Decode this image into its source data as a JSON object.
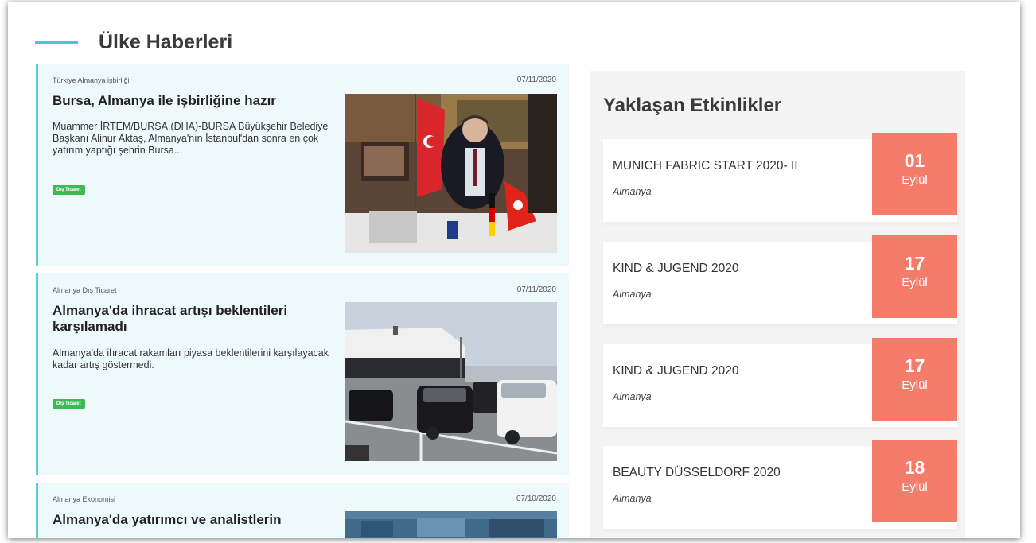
{
  "section": {
    "title": "Ülke Haberleri"
  },
  "news": [
    {
      "category": "Türkiye Almanya işbirliği",
      "date": "07/11/2020",
      "title": "Bursa, Almanya ile işbirliğine hazır",
      "summary": "Muammer İRTEM/BURSA,(DHA)-BURSA Büyükşehir Belediye Başkanı Alinur Aktaş, Almanya'nın İstanbul'dan sonra en çok yatırım yaptığı şehrin Bursa...",
      "tag": "Dış Ticaret"
    },
    {
      "category": "Almanya Dış Ticaret",
      "date": "07/11/2020",
      "title": "Almanya'da ihracat artışı beklentileri karşılamadı",
      "summary": "Almanya'da ihracat rakamları piyasa beklentilerini karşılayacak kadar artış göstermedi.",
      "tag": "Dış Ticaret"
    },
    {
      "category": "Almanya Ekonomisi",
      "date": "07/10/2020",
      "title": "Almanya'da yatırımcı ve analistlerin",
      "summary": "",
      "tag": ""
    }
  ],
  "events": {
    "title": "Yaklaşan Etkinlikler",
    "items": [
      {
        "name": "MUNICH FABRIC START 2020- II",
        "country": "Almanya",
        "day": "01",
        "month": "Eylül"
      },
      {
        "name": "KIND & JUGEND 2020",
        "country": "Almanya",
        "day": "17",
        "month": "Eylül"
      },
      {
        "name": "KIND & JUGEND 2020",
        "country": "Almanya",
        "day": "17",
        "month": "Eylül"
      },
      {
        "name": "BEAUTY DÜSSELDORF 2020",
        "country": "Almanya",
        "day": "18",
        "month": "Eylül"
      }
    ]
  },
  "colors": {
    "accent": "#4fc3dd",
    "card_bg": "#eef9fc",
    "tag_green": "#3cba54",
    "date_badge": "#f57c6b"
  }
}
